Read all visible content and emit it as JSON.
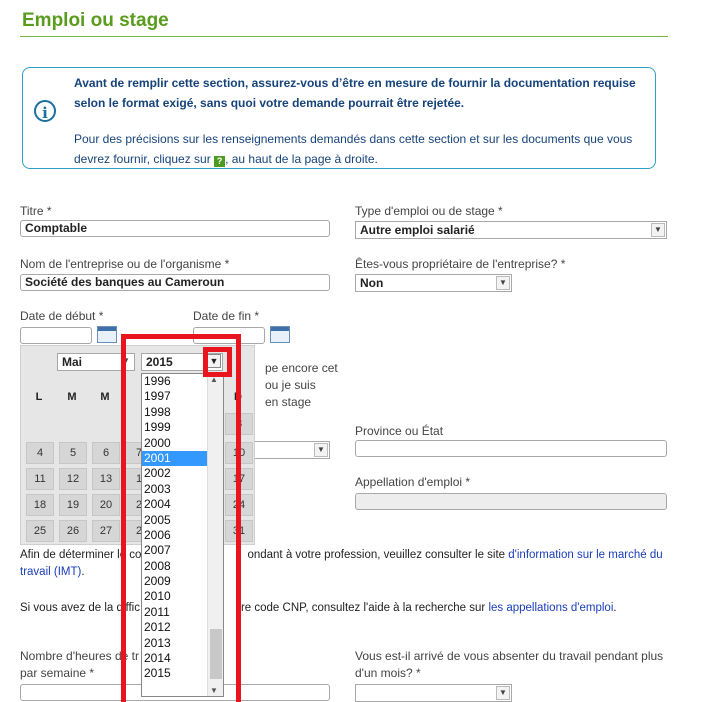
{
  "page": {
    "title": "Emploi ou stage"
  },
  "notice": {
    "strong": "Avant de remplir cette section, assurez-vous d’être en mesure de fournir la documentation requise selon le format exigé, sans quoi votre demande pourrait être rejetée.",
    "text_before": "Pour des précisions sur les renseignements demandés dans cette section et sur les documents que vous devrez fournir, cliquez sur",
    "help_glyph": "?",
    "text_after": ", au haut de la page à droite.",
    "icon": "info-icon"
  },
  "fields": {
    "titre": {
      "label": "Titre *",
      "value": "Comptable"
    },
    "type_emploi": {
      "label": "Type d'emploi ou de stage *",
      "value": "Autre emploi salarié"
    },
    "entreprise": {
      "label": "Nom de l'entreprise ou de l'organisme *",
      "value": "Société des banques au Cameroun"
    },
    "proprietaire": {
      "label": "Êtes-vous propriétaire de l'entreprise? *",
      "value": "Non"
    },
    "date_debut": {
      "label": "Date de début *",
      "value": ""
    },
    "date_fin": {
      "label": "Date de fin *",
      "value": ""
    },
    "occupe": {
      "partial_lines": [
        "pe encore cet",
        "ou je suis",
        "en stage"
      ]
    },
    "province": {
      "label": "Province ou État",
      "value": ""
    },
    "appellation": {
      "label": "Appellation d'emploi *",
      "value": ""
    },
    "heures": {
      "label_line1": "Nombre d'heures de tr",
      "label_line2": "par semaine *",
      "value": ""
    },
    "absence": {
      "label_line1": "Vous est-il arrivé de vous absenter du travail pendant plus",
      "label_line2": "d'un mois? *",
      "value": ""
    }
  },
  "calendar": {
    "month": "Mai",
    "year": "2015",
    "headers": [
      "L",
      "M",
      "M",
      "J",
      "V",
      "S",
      "D"
    ],
    "visible_days": {
      "row1": [
        "",
        "",
        "",
        "",
        "",
        "",
        "3"
      ],
      "row2": [
        "4",
        "5",
        "6",
        "7",
        "",
        "",
        "10"
      ],
      "row3": [
        "11",
        "12",
        "13",
        "1",
        "",
        "",
        "17"
      ],
      "row4": [
        "18",
        "19",
        "20",
        "2",
        "",
        "",
        "24"
      ],
      "row5": [
        "25",
        "26",
        "27",
        "2",
        "",
        "",
        "31"
      ]
    }
  },
  "year_dropdown": {
    "options": [
      "1996",
      "1997",
      "1998",
      "1999",
      "2000",
      "2001",
      "2002",
      "2003",
      "2004",
      "2005",
      "2006",
      "2007",
      "2008",
      "2009",
      "2010",
      "2011",
      "2012",
      "2013",
      "2014",
      "2015"
    ],
    "highlighted": "2001"
  },
  "paragraphs": {
    "imt_before": "Afin de déterminer le co",
    "imt_mid": "ondant à votre profession, veuillez consulter le site",
    "imt_link1": "d'information sur le marché du",
    "imt_link2": "travail (IMT)",
    "imt_end": ".",
    "cnp_before": "Si vous avez de la diffic",
    "cnp_mid": "re code CNP, consultez l'aide à la recherche sur",
    "cnp_link": "les appellations d'emploi",
    "cnp_end": "."
  },
  "colors": {
    "title": "#5a9c1e",
    "notice_border": "#2fa0c8",
    "notice_text": "#16437a",
    "highlight": "#e8141e",
    "selected": "#3399ff"
  }
}
